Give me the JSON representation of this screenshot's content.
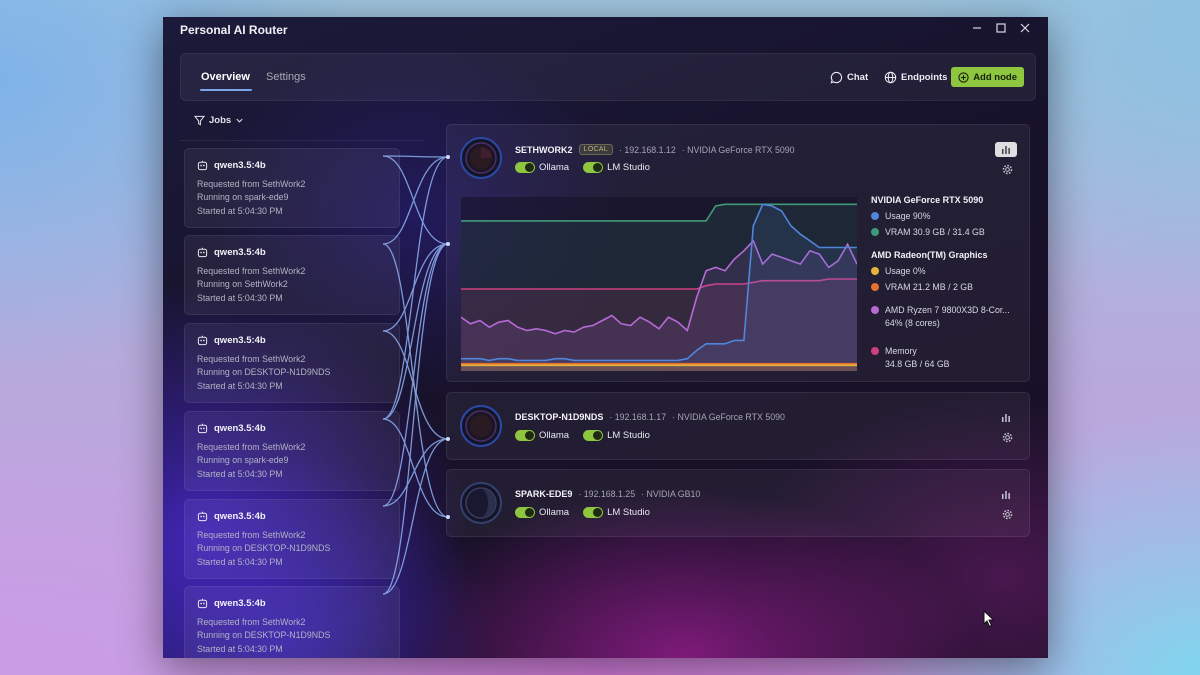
{
  "window": {
    "title": "Personal AI Router",
    "controls": [
      "minimize",
      "maximize",
      "close"
    ]
  },
  "nav": {
    "tabs": [
      {
        "label": "Overview",
        "active": true
      },
      {
        "label": "Settings",
        "active": false
      }
    ],
    "chat_label": "Chat",
    "endpoints_label": "Endpoints",
    "add_node_label": "Add node",
    "accent": "#8ec63f"
  },
  "jobs": {
    "header": "Jobs",
    "items": [
      {
        "model": "qwen3.5:4b",
        "requested": "Requested from SethWork2",
        "running": "Running on spark-ede9",
        "started": "Started at 5:04:30 PM"
      },
      {
        "model": "qwen3.5:4b",
        "requested": "Requested from SethWork2",
        "running": "Running on SethWork2",
        "started": "Started at 5:04:30 PM"
      },
      {
        "model": "qwen3.5:4b",
        "requested": "Requested from SethWork2",
        "running": "Running on DESKTOP-N1D9NDS",
        "started": "Started at 5:04:30 PM"
      },
      {
        "model": "qwen3.5:4b",
        "requested": "Requested from SethWork2",
        "running": "Running on spark-ede9",
        "started": "Started at 5:04:30 PM"
      },
      {
        "model": "qwen3.5:4b",
        "requested": "Requested from SethWork2",
        "running": "Running on DESKTOP-N1D9NDS",
        "started": "Started at 5:04:30 PM"
      },
      {
        "model": "qwen3.5:4b",
        "requested": "Requested from SethWork2",
        "running": "Running on DESKTOP-N1D9NDS",
        "started": "Started at 5:04:30 PM"
      }
    ]
  },
  "nodes": [
    {
      "name": "SETHWORK2",
      "badge": "LOCAL",
      "ip": "· 192.168.1.12",
      "gpu": "· NVIDIA GeForce RTX 5090",
      "services": [
        "Ollama",
        "LM Studio"
      ],
      "expanded": true
    },
    {
      "name": "DESKTOP-N1D9NDS",
      "ip": "· 192.168.1.17",
      "gpu": "· NVIDIA GeForce RTX 5090",
      "services": [
        "Ollama",
        "LM Studio"
      ],
      "expanded": false
    },
    {
      "name": "SPARK-EDE9",
      "ip": "· 192.168.1.25",
      "gpu": "· NVIDIA GB10",
      "services": [
        "Ollama",
        "LM Studio"
      ],
      "expanded": false
    }
  ],
  "legend": {
    "gpu1_title": "NVIDIA GeForce RTX 5090",
    "gpu1_usage": "Usage  90%",
    "gpu1_vram": "VRAM  30.9 GB / 31.4 GB",
    "gpu2_title": "AMD Radeon(TM) Graphics",
    "gpu2_usage": "Usage  0%",
    "gpu2_vram": "VRAM  21.2 MB / 2 GB",
    "cpu_title": "AMD Ryzen 7 9800X3D 8-Cor...",
    "cpu_sub": "64% (8 cores)",
    "mem_title": "Memory",
    "mem_sub": "34.8 GB / 64 GB"
  },
  "chart_data": {
    "type": "line",
    "ylim": [
      0,
      100
    ],
    "series": [
      {
        "name": "Usage",
        "color": "#4f86d9",
        "values": [
          5,
          5,
          5,
          4,
          5,
          5,
          4,
          4,
          4,
          4,
          5,
          5,
          4,
          4,
          4,
          4,
          4,
          4,
          4,
          4,
          4,
          4,
          4,
          4,
          5,
          10,
          14,
          14,
          14,
          16,
          16,
          85,
          98,
          97,
          94,
          85,
          80,
          76,
          72,
          72,
          72,
          72,
          72
        ]
      },
      {
        "name": "VRAM",
        "color": "#3f9a7a",
        "values": [
          88,
          88,
          88,
          88,
          88,
          88,
          88,
          88,
          88,
          88,
          88,
          88,
          88,
          88,
          88,
          88,
          88,
          88,
          88,
          88,
          88,
          88,
          88,
          88,
          88,
          88,
          88,
          97,
          98,
          98,
          98,
          98,
          98,
          98,
          98,
          98,
          98,
          98,
          98,
          98,
          98,
          98,
          98
        ]
      },
      {
        "name": "Usage",
        "color": "#e6b43c",
        "values": [
          1,
          1,
          1,
          1,
          1,
          1,
          1,
          1,
          1,
          1,
          1,
          1,
          1,
          1,
          1,
          1,
          1,
          1,
          1,
          1,
          1,
          1,
          1,
          1,
          1,
          1,
          1,
          1,
          1,
          1,
          1,
          1,
          1,
          1,
          1,
          1,
          1,
          1,
          1,
          1,
          1,
          1,
          1
        ]
      },
      {
        "name": "VRAM",
        "color": "#e2722e",
        "values": [
          2,
          2,
          2,
          2,
          2,
          2,
          2,
          2,
          2,
          2,
          2,
          2,
          2,
          2,
          2,
          2,
          2,
          2,
          2,
          2,
          2,
          2,
          2,
          2,
          2,
          2,
          2,
          2,
          2,
          2,
          2,
          2,
          2,
          2,
          2,
          2,
          2,
          2,
          2,
          2,
          2,
          2,
          2
        ]
      },
      {
        "name": "AMD Ryzen 7 9800X3D 8-Cor...",
        "color": "#b56ad6",
        "values": [
          30,
          26,
          28,
          24,
          27,
          28,
          24,
          22,
          23,
          22,
          20,
          22,
          21,
          24,
          25,
          28,
          31,
          26,
          25,
          30,
          27,
          23,
          30,
          27,
          22,
          42,
          58,
          60,
          58,
          65,
          70,
          76,
          62,
          68,
          66,
          64,
          62,
          70,
          68,
          60,
          64,
          74,
          62
        ]
      },
      {
        "name": "Memory",
        "color": "#cf3f7f",
        "values": [
          47,
          47,
          47,
          47,
          47,
          47,
          47,
          47,
          47,
          47,
          47,
          47,
          47,
          47,
          47,
          47,
          47,
          47,
          47,
          47,
          47,
          47,
          47,
          47,
          47,
          47,
          49,
          50,
          50,
          50,
          50,
          51,
          52,
          52,
          52,
          52,
          52,
          52,
          52,
          53,
          53,
          53,
          53
        ]
      }
    ]
  }
}
